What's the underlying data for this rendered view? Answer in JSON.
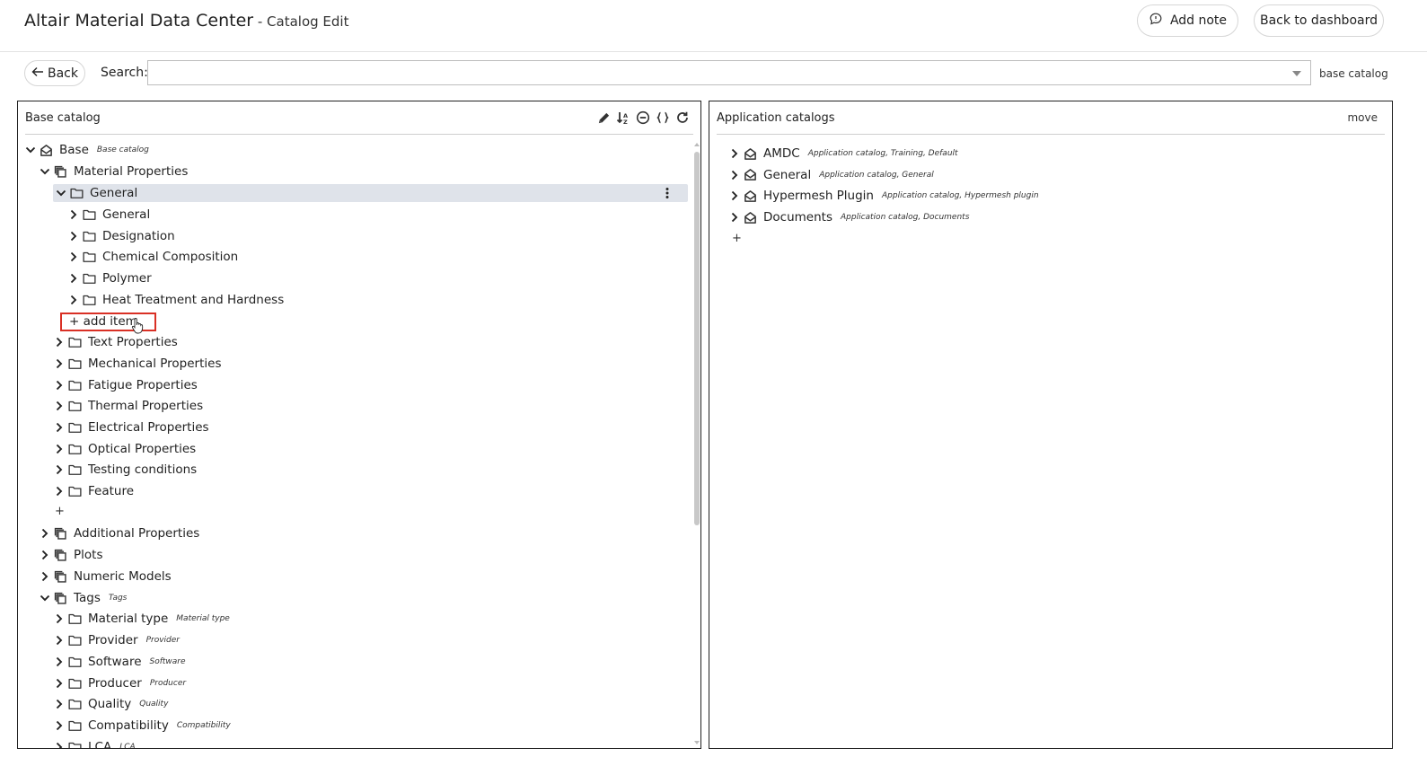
{
  "header": {
    "app_title": "Altair Material Data Center",
    "app_subtitle": " - Catalog Edit",
    "add_note_label": "Add note",
    "back_dashboard_label": "Back to dashboard"
  },
  "searchbar": {
    "back_label": "Back",
    "search_label": "Search:",
    "search_value": "",
    "scope_label": "base catalog"
  },
  "left_panel": {
    "title": "Base catalog",
    "toolbar_icons": [
      "pencil-icon",
      "sort-icon",
      "collapse-icon",
      "braces-icon",
      "refresh-icon"
    ],
    "add_item_label": "+ add item",
    "plus_label": "+",
    "tree": [
      {
        "label": "Base",
        "tag": "Base catalog",
        "icon": "catalog-icon",
        "expanded": true
      },
      {
        "label": "Material Properties",
        "tag": "",
        "icon": "stack-icon",
        "expanded": true
      },
      {
        "label": "General",
        "tag": "",
        "icon": "folder-icon",
        "expanded": true,
        "selected": true
      },
      {
        "label": "General",
        "tag": "",
        "icon": "folder-icon",
        "expanded": false
      },
      {
        "label": "Designation",
        "tag": "",
        "icon": "folder-icon",
        "expanded": false
      },
      {
        "label": "Chemical Composition",
        "tag": "",
        "icon": "folder-icon",
        "expanded": false
      },
      {
        "label": "Polymer",
        "tag": "",
        "icon": "folder-icon",
        "expanded": false
      },
      {
        "label": "Heat Treatment and Hardness",
        "tag": "",
        "icon": "folder-icon",
        "expanded": false
      },
      {
        "label": "Text Properties",
        "tag": "",
        "icon": "folder-icon",
        "expanded": false
      },
      {
        "label": "Mechanical Properties",
        "tag": "",
        "icon": "folder-icon",
        "expanded": false
      },
      {
        "label": "Fatigue Properties",
        "tag": "",
        "icon": "folder-icon",
        "expanded": false
      },
      {
        "label": "Thermal Properties",
        "tag": "",
        "icon": "folder-icon",
        "expanded": false
      },
      {
        "label": "Electrical Properties",
        "tag": "",
        "icon": "folder-icon",
        "expanded": false
      },
      {
        "label": "Optical Properties",
        "tag": "",
        "icon": "folder-icon",
        "expanded": false
      },
      {
        "label": "Testing conditions",
        "tag": "",
        "icon": "folder-icon",
        "expanded": false
      },
      {
        "label": "Feature",
        "tag": "",
        "icon": "folder-icon",
        "expanded": false
      },
      {
        "label": "Additional Properties",
        "tag": "",
        "icon": "stack-icon",
        "expanded": false
      },
      {
        "label": "Plots",
        "tag": "",
        "icon": "stack-icon",
        "expanded": false
      },
      {
        "label": "Numeric Models",
        "tag": "",
        "icon": "stack-icon",
        "expanded": false
      },
      {
        "label": "Tags",
        "tag": "Tags",
        "icon": "stack-icon",
        "expanded": true
      },
      {
        "label": "Material type",
        "tag": "Material type",
        "icon": "folder-icon",
        "expanded": false
      },
      {
        "label": "Provider",
        "tag": "Provider",
        "icon": "folder-icon",
        "expanded": false
      },
      {
        "label": "Software",
        "tag": "Software",
        "icon": "folder-icon",
        "expanded": false
      },
      {
        "label": "Producer",
        "tag": "Producer",
        "icon": "folder-icon",
        "expanded": false
      },
      {
        "label": "Quality",
        "tag": "Quality",
        "icon": "folder-icon",
        "expanded": false
      },
      {
        "label": "Compatibility",
        "tag": "Compatibility",
        "icon": "folder-icon",
        "expanded": false
      },
      {
        "label": "LCA",
        "tag": "LCA",
        "icon": "folder-icon",
        "expanded": false
      }
    ]
  },
  "right_panel": {
    "title": "Application catalogs",
    "move_label": "move",
    "plus_label": "+",
    "tree": [
      {
        "label": "AMDC",
        "tag": "Application catalog, Training, Default",
        "icon": "catalog-icon"
      },
      {
        "label": "General",
        "tag": "Application catalog, General",
        "icon": "catalog-icon"
      },
      {
        "label": "Hypermesh Plugin",
        "tag": "Application catalog, Hypermesh plugin",
        "icon": "catalog-icon"
      },
      {
        "label": "Documents",
        "tag": "Application catalog, Documents",
        "icon": "catalog-icon"
      }
    ]
  }
}
